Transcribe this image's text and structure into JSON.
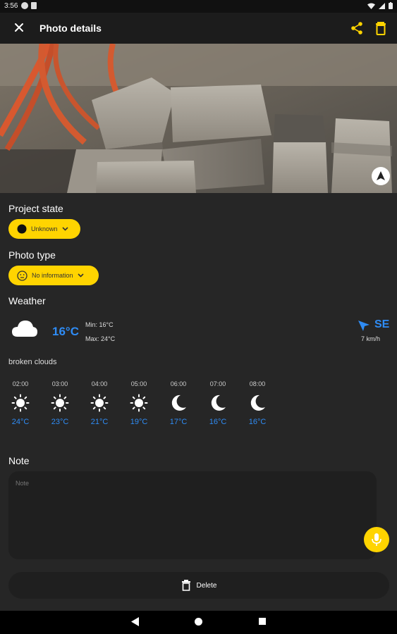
{
  "status_bar": {
    "time": "3:56"
  },
  "header": {
    "title": "Photo details"
  },
  "project_state": {
    "label": "Project state",
    "value": "Unknown"
  },
  "photo_type": {
    "label": "Photo type",
    "value": "No information"
  },
  "weather": {
    "label": "Weather",
    "temperature": "16°C",
    "min": "Min:  16°C",
    "max": "Max: 24°C",
    "wind_direction": "SE",
    "wind_speed": "7 km/h",
    "description": "broken clouds",
    "hourly": [
      {
        "time": "02:00",
        "icon": "sun-icon",
        "temp": "24°C"
      },
      {
        "time": "03:00",
        "icon": "sun-icon",
        "temp": "23°C"
      },
      {
        "time": "04:00",
        "icon": "sun-icon",
        "temp": "21°C"
      },
      {
        "time": "05:00",
        "icon": "sun-icon",
        "temp": "19°C"
      },
      {
        "time": "06:00",
        "icon": "moon-icon",
        "temp": "17°C"
      },
      {
        "time": "07:00",
        "icon": "moon-icon",
        "temp": "16°C"
      },
      {
        "time": "08:00",
        "icon": "moon-icon",
        "temp": "16°C"
      }
    ]
  },
  "note": {
    "label": "Note",
    "placeholder": "Note"
  },
  "delete": {
    "label": "Delete"
  },
  "colors": {
    "accent": "#ffd400",
    "temp_blue": "#2f8cf5",
    "background": "#262626"
  }
}
